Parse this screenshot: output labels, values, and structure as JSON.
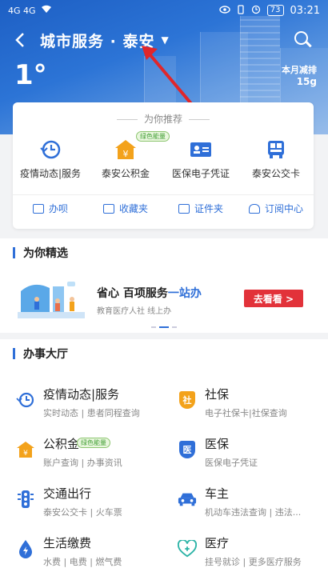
{
  "status_bar": {
    "network": "4G 4G",
    "battery": "73",
    "time": "03:21"
  },
  "header": {
    "title": "城市服务 · 泰安",
    "temperature": "1°",
    "carbon_label": "本月减排",
    "carbon_value": "15g"
  },
  "recommend": {
    "title": "为你推荐",
    "items": [
      {
        "label": "疫情动态|服务",
        "icon": "clock-icon"
      },
      {
        "label": "泰安公积金",
        "icon": "fund-icon",
        "tag": "绿色能量"
      },
      {
        "label": "医保电子凭证",
        "icon": "card-icon"
      },
      {
        "label": "泰安公交卡",
        "icon": "bus-icon"
      }
    ],
    "links": [
      {
        "label": "办呗"
      },
      {
        "label": "收藏夹"
      },
      {
        "label": "证件夹"
      },
      {
        "label": "订阅中心"
      }
    ]
  },
  "featured": {
    "title": "为你精选",
    "banner_main_prefix": "省心 百项服务",
    "banner_main_highlight": "一站办",
    "banner_sub": "教育医疗人社 线上办",
    "button": "去看看 >"
  },
  "hall": {
    "title": "办事大厅",
    "services": [
      {
        "name": "疫情动态|服务",
        "desc": "实时动态 | 患者同程查询",
        "icon": "clock-icon"
      },
      {
        "name": "社保",
        "desc": "电子社保卡|社保查询",
        "icon": "shield-icon",
        "badge": "社"
      },
      {
        "name": "公积金",
        "desc": "账户查询 | 办事资讯",
        "icon": "fund-icon",
        "tag": "绿色能量"
      },
      {
        "name": "医保",
        "desc": "医保电子凭证",
        "icon": "shield-icon",
        "badge": "医"
      },
      {
        "name": "交通出行",
        "desc": "泰安公交卡 | 火车票",
        "icon": "traffic-light-icon"
      },
      {
        "name": "车主",
        "desc": "机动车违法查询 | 违法...",
        "icon": "car-icon"
      },
      {
        "name": "生活缴费",
        "desc": "水费 | 电费 | 燃气费",
        "icon": "drop-icon"
      },
      {
        "name": "医疗",
        "desc": "挂号就诊 | 更多医疗服务",
        "icon": "medical-icon"
      }
    ]
  },
  "colors": {
    "accent": "#2f6fd8",
    "orange": "#f3a21b",
    "red_button": "#e2323a",
    "green_tag": "#46a13a"
  }
}
